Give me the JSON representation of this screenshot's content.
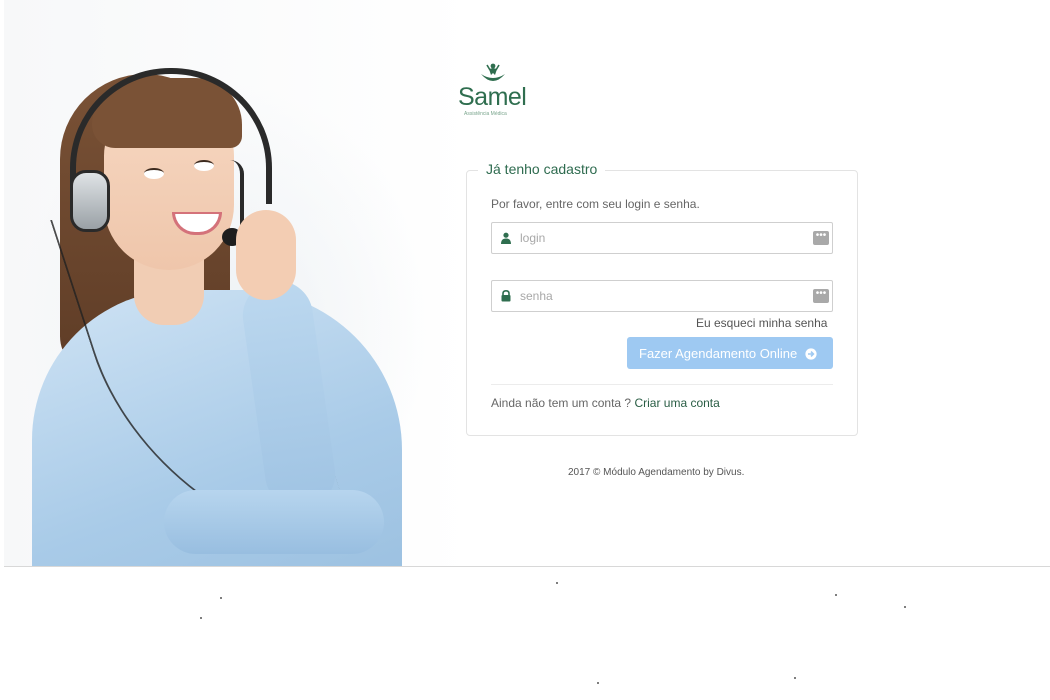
{
  "logo": {
    "name": "Samel",
    "subtitle": "Assistência Médica"
  },
  "login_panel": {
    "legend": "Já tenho cadastro",
    "intro": "Por favor, entre com seu login e senha.",
    "login_field": {
      "placeholder": "login",
      "value": "",
      "icon": "user-icon"
    },
    "password_field": {
      "placeholder": "senha",
      "value": "",
      "icon": "lock-icon"
    },
    "field_action_icon": "ellipsis-icon",
    "forgot_link": "Eu esqueci minha senha",
    "submit_label": "Fazer Agendamento Online",
    "submit_icon": "arrow-circle-right-icon",
    "signup_prompt": "Ainda não tem um conta ?",
    "signup_link": "Criar uma conta"
  },
  "footer": {
    "text": "2017 © Módulo Agendamento by Divus."
  },
  "colors": {
    "brand_green": "#2f6e4f",
    "button_blue": "#9ec9f2",
    "link_green": "#2a5e45"
  }
}
